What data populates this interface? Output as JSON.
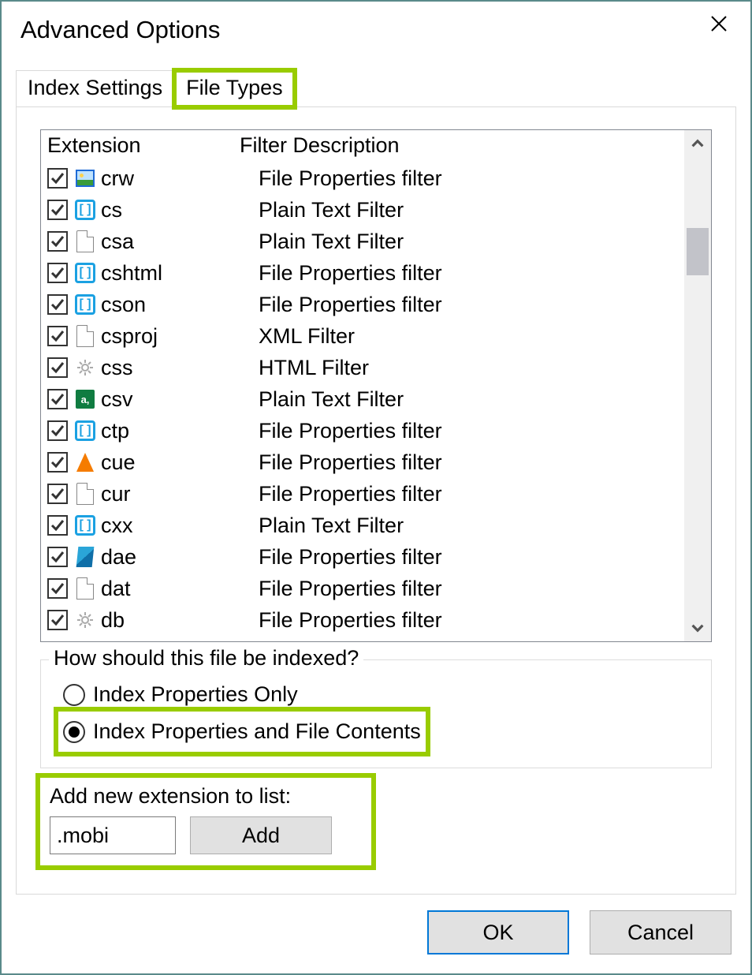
{
  "window": {
    "title": "Advanced Options"
  },
  "tabs": {
    "index_settings": "Index Settings",
    "file_types": "File Types",
    "active": "file_types"
  },
  "columns": {
    "extension": "Extension",
    "filter": "Filter Description"
  },
  "rows": [
    {
      "checked": true,
      "icon": "img",
      "ext": "crw",
      "desc": "File Properties filter"
    },
    {
      "checked": true,
      "icon": "bracket",
      "ext": "cs",
      "desc": "Plain Text Filter"
    },
    {
      "checked": true,
      "icon": "page",
      "ext": "csa",
      "desc": "Plain Text Filter"
    },
    {
      "checked": true,
      "icon": "bracket",
      "ext": "cshtml",
      "desc": "File Properties filter"
    },
    {
      "checked": true,
      "icon": "bracket",
      "ext": "cson",
      "desc": "File Properties filter"
    },
    {
      "checked": true,
      "icon": "page",
      "ext": "csproj",
      "desc": "XML Filter"
    },
    {
      "checked": true,
      "icon": "gear",
      "ext": "css",
      "desc": "HTML Filter"
    },
    {
      "checked": true,
      "icon": "xls",
      "ext": "csv",
      "desc": "Plain Text Filter"
    },
    {
      "checked": true,
      "icon": "bracket",
      "ext": "ctp",
      "desc": "File Properties filter"
    },
    {
      "checked": true,
      "icon": "vlc",
      "ext": "cue",
      "desc": "File Properties filter"
    },
    {
      "checked": true,
      "icon": "page",
      "ext": "cur",
      "desc": "File Properties filter"
    },
    {
      "checked": true,
      "icon": "bracket",
      "ext": "cxx",
      "desc": "Plain Text Filter"
    },
    {
      "checked": true,
      "icon": "blue3d",
      "ext": "dae",
      "desc": "File Properties filter"
    },
    {
      "checked": true,
      "icon": "page",
      "ext": "dat",
      "desc": "File Properties filter"
    },
    {
      "checked": true,
      "icon": "gear",
      "ext": "db",
      "desc": "File Properties filter"
    }
  ],
  "index_group": {
    "legend": "How should this file be indexed?",
    "opt_props_only": "Index Properties Only",
    "opt_props_contents": "Index Properties and File Contents",
    "selected": "contents"
  },
  "add": {
    "label": "Add new extension to list:",
    "value": ".mobi",
    "button": "Add"
  },
  "footer": {
    "ok": "OK",
    "cancel": "Cancel"
  }
}
